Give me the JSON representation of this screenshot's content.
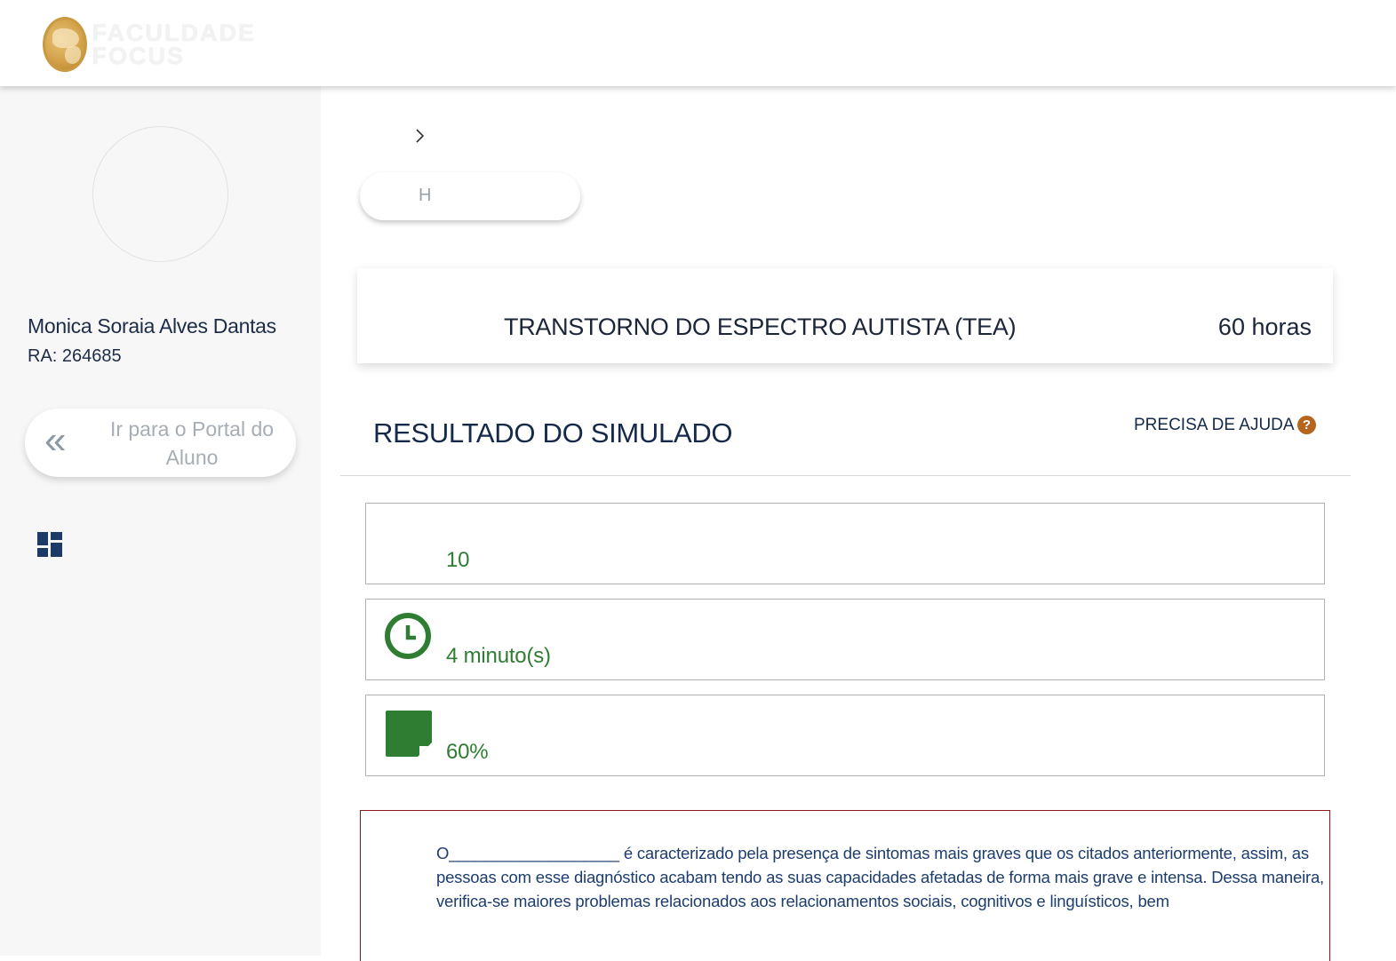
{
  "header": {
    "logo_line1": "FACULDADE",
    "logo_line2": "FOCUS",
    "logo_icon": "globe-logo-icon"
  },
  "sidebar": {
    "user_name": "Monica Soraia Alves Dantas",
    "ra_label": "RA:",
    "ra_value": "264685",
    "portal_button_label": "Ir para o Portal do Aluno",
    "portal_button_icon": "double-chevron-left-icon",
    "dashboard_icon": "dashboard-icon"
  },
  "breadcrumb": {
    "separator_icon": "chevron-right-icon"
  },
  "pill_button": {
    "label": "H"
  },
  "course": {
    "title": "TRANSTORNO DO ESPECTRO AUTISTA (TEA)",
    "hours": "60 horas"
  },
  "result": {
    "title": "RESULTADO DO SIMULADO",
    "help_label": "PRECISA DE AJUDA",
    "help_icon_glyph": "?"
  },
  "stats": [
    {
      "value": "10",
      "icon": "none"
    },
    {
      "value": "4 minuto(s)",
      "icon": "clock-icon"
    },
    {
      "value": "60%",
      "icon": "note-icon"
    }
  ],
  "question": {
    "text": "O___________________ é caracterizado pela presença de sintomas mais graves que os citados anteriormente, assim, as pessoas com esse diagnóstico acabam tendo as suas capacidades afetadas de forma mais grave e intensa. Dessa maneira, verifica-se maiores problemas relacionados aos relacionamentos sociais, cognitivos e linguísticos, bem"
  },
  "colors": {
    "accent_green": "#2e7d32",
    "navy": "#15294a",
    "help_orange": "#b5651d",
    "question_border": "#8b1a1a",
    "logo_gold": "#d4a24a"
  }
}
